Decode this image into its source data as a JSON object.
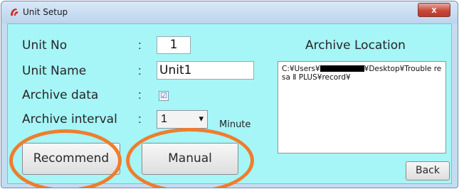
{
  "window": {
    "title": "Unit Setup",
    "close_glyph": "x",
    "icon": "app-logo-icon",
    "colors": {
      "client_bg": "#a6f5f7",
      "highlight_ring": "#ef7d2d",
      "title_bg": "#c5dcf0"
    }
  },
  "form": {
    "unit_no": {
      "label": "Unit No",
      "colon": ":",
      "value": "1"
    },
    "unit_name": {
      "label": "Unit Name",
      "colon": ":",
      "value": "Unit1"
    },
    "archive_data": {
      "label": "Archive data",
      "colon": ":",
      "checked": true,
      "check_glyph": "☑"
    },
    "archive_interval": {
      "label": "Archive interval",
      "colon": ":",
      "value": "1",
      "unit": "Minute",
      "arrow": "▾"
    }
  },
  "archive": {
    "heading": "Archive Location",
    "path_prefix": "C:¥Users¥",
    "path_suffix": "¥Desktop¥Trouble resa Ⅱ PLUS¥record¥"
  },
  "buttons": {
    "recommend": "Recommend",
    "manual": "Manual",
    "back": "Back"
  }
}
